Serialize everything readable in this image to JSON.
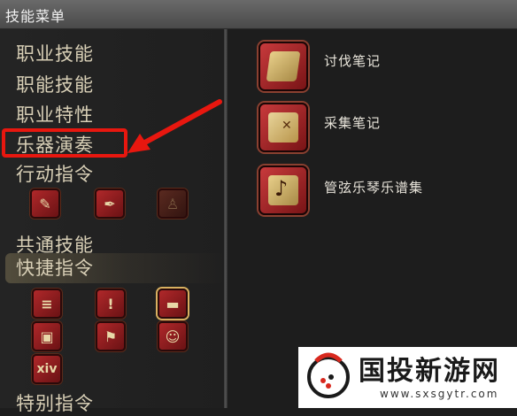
{
  "window": {
    "title": "技能菜单"
  },
  "categories": [
    {
      "label": "职业技能"
    },
    {
      "label": "职能技能"
    },
    {
      "label": "职业特性"
    },
    {
      "label": "乐器演奏"
    },
    {
      "label": "行动指令"
    },
    {
      "label": "共通技能"
    },
    {
      "label": "快捷指令"
    },
    {
      "label": "特别指令"
    }
  ],
  "action_icons": [
    {
      "icon": "sign-board-icon"
    },
    {
      "icon": "book-quill-icon"
    },
    {
      "icon": "figure-icon"
    }
  ],
  "shortcut_icons": [
    {
      "icon": "list-person-icon"
    },
    {
      "icon": "exclamation-icon"
    },
    {
      "icon": "book-icon"
    },
    {
      "icon": "map-info-icon"
    },
    {
      "icon": "flag-list-icon"
    },
    {
      "icon": "faces-icon"
    },
    {
      "icon": "xiv-icon",
      "text": "xiv"
    }
  ],
  "items": [
    {
      "label": "讨伐笔记",
      "icon": "hunting-log-icon"
    },
    {
      "label": "采集笔记",
      "icon": "gathering-log-map-icon"
    },
    {
      "label": "管弦乐琴乐谱集",
      "icon": "orchestrion-songbook-icon"
    }
  ],
  "annotation": {
    "color": "#e8170f"
  },
  "watermark": {
    "brand": "国投新游网",
    "url": "www.sxsgytr.com"
  }
}
